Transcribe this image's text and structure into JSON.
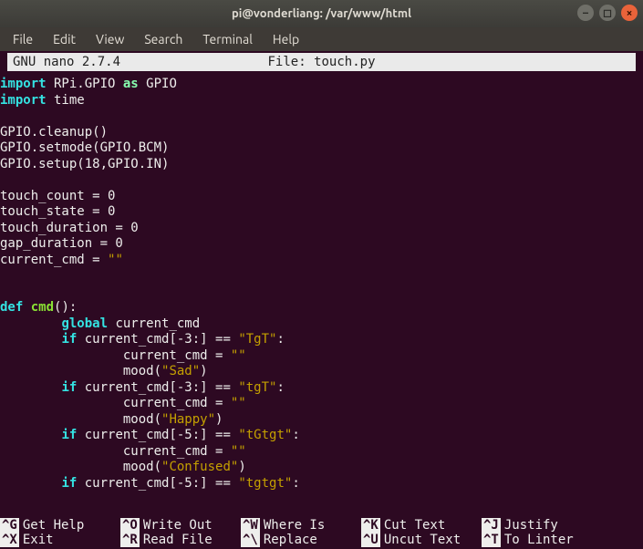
{
  "titlebar": {
    "title": "pi@vonderliang: /var/www/html"
  },
  "menubar": {
    "items": [
      "File",
      "Edit",
      "View",
      "Search",
      "Terminal",
      "Help"
    ]
  },
  "nano": {
    "version_label": "  GNU nano 2.7.4",
    "file_label": "File: touch.py"
  },
  "code": {
    "lines": [
      [
        [
          "kw",
          "import"
        ],
        [
          "text",
          " RPi.GPIO "
        ],
        [
          "kw2",
          "as"
        ],
        [
          "text",
          " GPIO"
        ]
      ],
      [
        [
          "kw",
          "import"
        ],
        [
          "text",
          " time"
        ]
      ],
      [],
      [
        [
          "text",
          "GPIO.cleanup()"
        ]
      ],
      [
        [
          "text",
          "GPIO.setmode(GPIO.BCM)"
        ]
      ],
      [
        [
          "text",
          "GPIO.setup(18,GPIO.IN)"
        ]
      ],
      [],
      [
        [
          "text",
          "touch_count = 0"
        ]
      ],
      [
        [
          "text",
          "touch_state = 0"
        ]
      ],
      [
        [
          "text",
          "touch_duration = 0"
        ]
      ],
      [
        [
          "text",
          "gap_duration = 0"
        ]
      ],
      [
        [
          "text",
          "current_cmd = "
        ],
        [
          "str",
          "\"\""
        ]
      ],
      [],
      [],
      [
        [
          "kw",
          "def"
        ],
        [
          "text",
          " "
        ],
        [
          "fn",
          "cmd"
        ],
        [
          "text",
          "():"
        ]
      ],
      [
        [
          "text",
          "        "
        ],
        [
          "kw",
          "global"
        ],
        [
          "text",
          " current_cmd"
        ]
      ],
      [
        [
          "text",
          "        "
        ],
        [
          "kw",
          "if"
        ],
        [
          "text",
          " current_cmd[-3:] == "
        ],
        [
          "str",
          "\"TgT\""
        ],
        [
          "text",
          ":"
        ]
      ],
      [
        [
          "text",
          "                current_cmd = "
        ],
        [
          "str",
          "\"\""
        ]
      ],
      [
        [
          "text",
          "                mood("
        ],
        [
          "str",
          "\"Sad\""
        ],
        [
          "text",
          ")"
        ]
      ],
      [
        [
          "text",
          "        "
        ],
        [
          "kw",
          "if"
        ],
        [
          "text",
          " current_cmd[-3:] == "
        ],
        [
          "str",
          "\"tgT\""
        ],
        [
          "text",
          ":"
        ]
      ],
      [
        [
          "text",
          "                current_cmd = "
        ],
        [
          "str",
          "\"\""
        ]
      ],
      [
        [
          "text",
          "                mood("
        ],
        [
          "str",
          "\"Happy\""
        ],
        [
          "text",
          ")"
        ]
      ],
      [
        [
          "text",
          "        "
        ],
        [
          "kw",
          "if"
        ],
        [
          "text",
          " current_cmd[-5:] == "
        ],
        [
          "str",
          "\"tGtgt\""
        ],
        [
          "text",
          ":"
        ]
      ],
      [
        [
          "text",
          "                current_cmd = "
        ],
        [
          "str",
          "\"\""
        ]
      ],
      [
        [
          "text",
          "                mood("
        ],
        [
          "str",
          "\"Confused\""
        ],
        [
          "text",
          ")"
        ]
      ],
      [
        [
          "text",
          "        "
        ],
        [
          "kw",
          "if"
        ],
        [
          "text",
          " current_cmd[-5:] == "
        ],
        [
          "str",
          "\"tgtgt\""
        ],
        [
          "text",
          ":"
        ]
      ]
    ]
  },
  "shortcuts": {
    "row1": [
      {
        "key": "^G",
        "label": "Get Help"
      },
      {
        "key": "^O",
        "label": "Write Out"
      },
      {
        "key": "^W",
        "label": "Where Is"
      },
      {
        "key": "^K",
        "label": "Cut Text"
      },
      {
        "key": "^J",
        "label": "Justify"
      }
    ],
    "row2": [
      {
        "key": "^X",
        "label": "Exit"
      },
      {
        "key": "^R",
        "label": "Read File"
      },
      {
        "key": "^\\",
        "label": "Replace"
      },
      {
        "key": "^U",
        "label": "Uncut Text"
      },
      {
        "key": "^T",
        "label": "To Linter"
      }
    ]
  }
}
